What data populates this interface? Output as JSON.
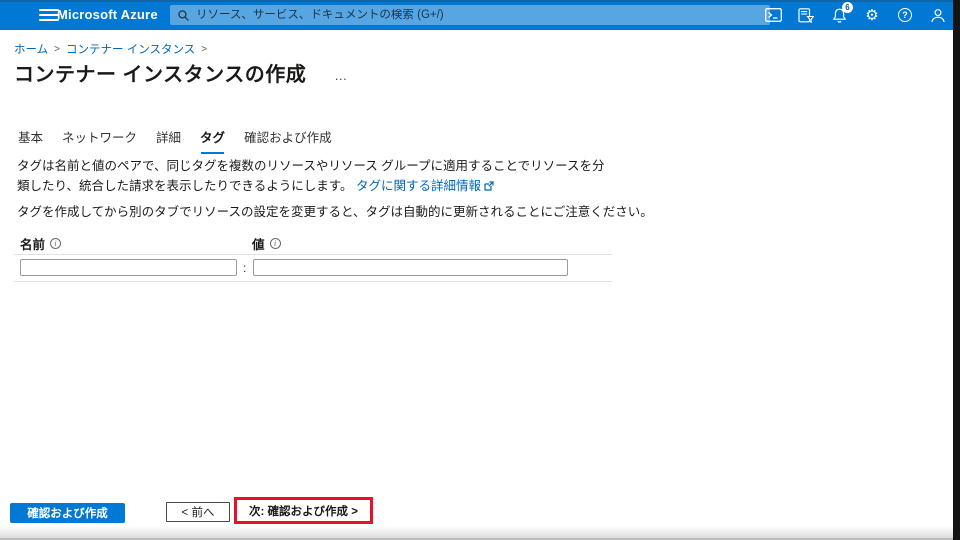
{
  "topbar": {
    "brand": "Microsoft Azure",
    "search_placeholder": "リソース、サービス、ドキュメントの検索 (G+/)",
    "notification_count": "6",
    "icons": {
      "gear": "⚙",
      "help": "?"
    }
  },
  "breadcrumb": {
    "items": [
      "ホーム",
      "コンテナー インスタンス"
    ],
    "separator": ">"
  },
  "page": {
    "title": "コンテナー インスタンスの作成",
    "title_menu": "…"
  },
  "tabs": [
    {
      "label": "基本",
      "active": false
    },
    {
      "label": "ネットワーク",
      "active": false
    },
    {
      "label": "詳細",
      "active": false
    },
    {
      "label": "タグ",
      "active": true
    },
    {
      "label": "確認および作成",
      "active": false
    }
  ],
  "content": {
    "description": "タグは名前と値のペアで、同じタグを複数のリソースやリソース グループに適用することでリソースを分類したり、統合した請求を表示したりできるようにします。",
    "learn_more_link": "タグに関する詳細情報",
    "note": "タグを作成してから別のタブでリソースの設定を変更すると、タグは自動的に更新されることにご注意ください。",
    "form": {
      "name_label": "名前",
      "value_label": "値",
      "info_glyph": "i",
      "separator": ":",
      "name_value": "",
      "value_value": ""
    }
  },
  "footer": {
    "review_create_button": "確認および作成",
    "previous_button": "< 前へ",
    "next_button": "次: 確認および作成 >"
  },
  "colors": {
    "topbar_bg": "#0078d4",
    "accent": "#0078d4",
    "link": "#0067b8",
    "annotation_red": "#e8112d"
  }
}
